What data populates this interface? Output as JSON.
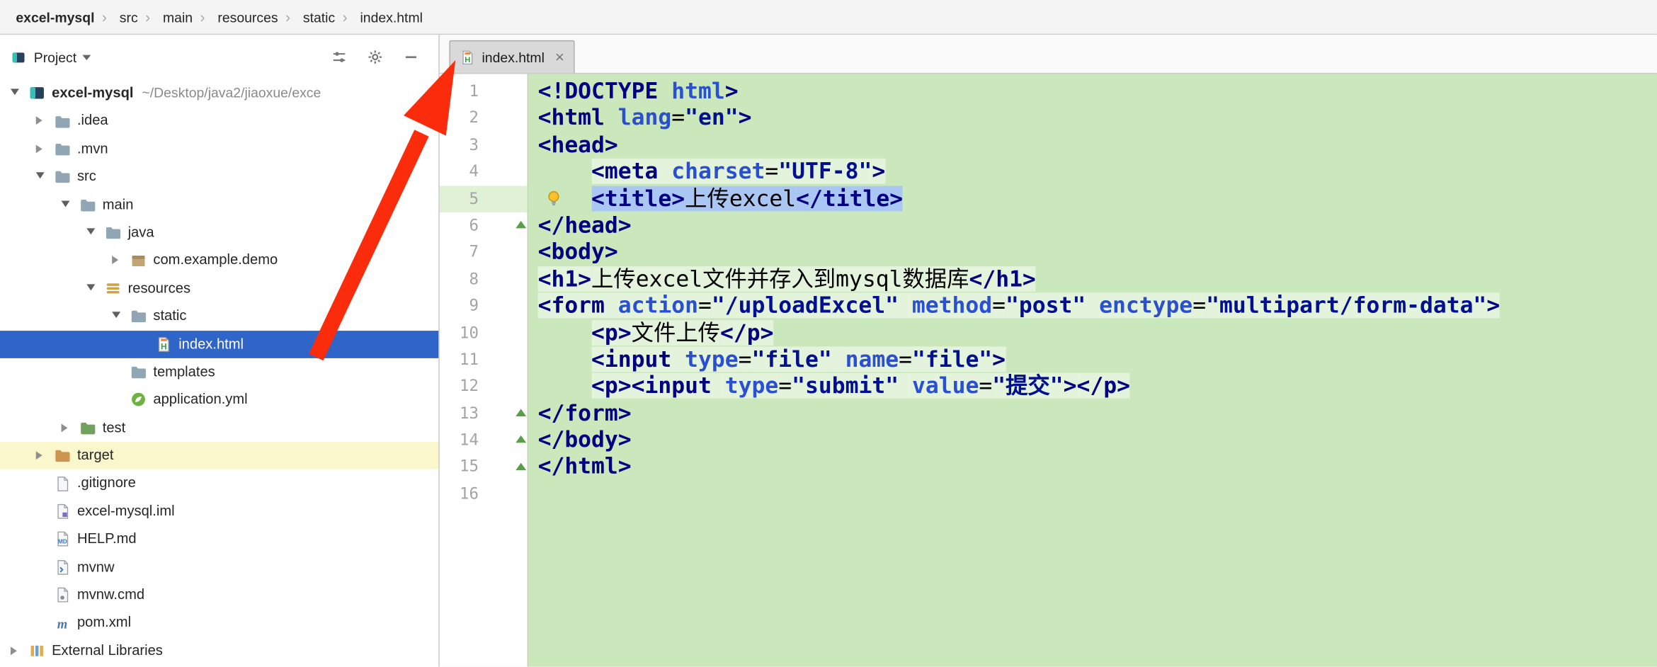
{
  "breadcrumbs": {
    "separator": "›",
    "items": [
      {
        "label": "excel-mysql",
        "icon": "module"
      },
      {
        "label": "src",
        "icon": "folder"
      },
      {
        "label": "main",
        "icon": "folder"
      },
      {
        "label": "resources",
        "icon": "resources"
      },
      {
        "label": "static",
        "icon": "folder"
      },
      {
        "label": "index.html",
        "icon": "html"
      }
    ]
  },
  "project_panel": {
    "title": "Project",
    "tree": [
      {
        "label": "excel-mysql",
        "path_hint": "~/Desktop/java2/jiaoxue/exce",
        "level": 0,
        "arrow": "expanded",
        "icon": "module",
        "bold": true
      },
      {
        "label": ".idea",
        "level": 1,
        "arrow": "collapsed",
        "icon": "folder"
      },
      {
        "label": ".mvn",
        "level": 1,
        "arrow": "collapsed",
        "icon": "folder"
      },
      {
        "label": "src",
        "level": 1,
        "arrow": "expanded",
        "icon": "folder"
      },
      {
        "label": "main",
        "level": 2,
        "arrow": "expanded",
        "icon": "folder"
      },
      {
        "label": "java",
        "level": 3,
        "arrow": "expanded",
        "icon": "folder"
      },
      {
        "label": "com.example.demo",
        "level": 4,
        "arrow": "collapsed",
        "icon": "package"
      },
      {
        "label": "resources",
        "level": 3,
        "arrow": "expanded",
        "icon": "resources"
      },
      {
        "label": "static",
        "level": 4,
        "arrow": "expanded",
        "icon": "folder"
      },
      {
        "label": "index.html",
        "level": 5,
        "arrow": "none",
        "icon": "html",
        "selected": true
      },
      {
        "label": "templates",
        "level": 4,
        "arrow": "none",
        "icon": "folder"
      },
      {
        "label": "application.yml",
        "level": 4,
        "arrow": "none",
        "icon": "yml"
      },
      {
        "label": "test",
        "level": 2,
        "arrow": "collapsed",
        "icon": "folder-test"
      },
      {
        "label": "target",
        "level": 1,
        "arrow": "collapsed",
        "icon": "folder-excluded",
        "highlight": "target"
      },
      {
        "label": ".gitignore",
        "level": 1,
        "arrow": "none",
        "icon": "file"
      },
      {
        "label": "excel-mysql.iml",
        "level": 1,
        "arrow": "none",
        "icon": "iml"
      },
      {
        "label": "HELP.md",
        "level": 1,
        "arrow": "none",
        "icon": "md"
      },
      {
        "label": "mvnw",
        "level": 1,
        "arrow": "none",
        "icon": "script"
      },
      {
        "label": "mvnw.cmd",
        "level": 1,
        "arrow": "none",
        "icon": "cmd"
      },
      {
        "label": "pom.xml",
        "level": 1,
        "arrow": "none",
        "icon": "maven"
      },
      {
        "label": "External Libraries",
        "level": 0,
        "arrow": "collapsed",
        "icon": "libraries"
      }
    ]
  },
  "editor": {
    "tab": {
      "label": "index.html",
      "close": "×",
      "icon": "html"
    },
    "gutter": {
      "bulb_line": 5,
      "fold_lines": [
        6,
        13,
        14,
        15
      ]
    },
    "lines": [
      [
        [
          "<!DOCTYPE ",
          "tag"
        ],
        [
          "html",
          "attr"
        ],
        [
          ">",
          "tag"
        ]
      ],
      [
        [
          "<html ",
          "tag"
        ],
        [
          "lang",
          "attr"
        ],
        [
          "=",
          "pln"
        ],
        [
          "\"en\"",
          "val"
        ],
        [
          ">",
          "tag"
        ]
      ],
      [
        [
          "<head>",
          "tag"
        ]
      ],
      [
        [
          "    ",
          "pln"
        ],
        [
          "<meta ",
          "tag hl"
        ],
        [
          "charset",
          "attr hl"
        ],
        [
          "=",
          "pln hl"
        ],
        [
          "\"UTF-8\"",
          "val hl"
        ],
        [
          ">",
          "tag hl"
        ]
      ],
      [
        [
          "    ",
          "pln"
        ],
        [
          "<title>",
          "tag sel"
        ],
        [
          "上传excel",
          "pln sel"
        ],
        [
          "</title>",
          "tag sel"
        ]
      ],
      [
        [
          "</head>",
          "tag"
        ]
      ],
      [
        [
          "<body>",
          "tag"
        ]
      ],
      [
        [
          "<h1>",
          "tag hl"
        ],
        [
          "上传excel文件并存入到mysql数据库",
          "pln hl"
        ],
        [
          "</h1>",
          "tag hl"
        ]
      ],
      [
        [
          "<form ",
          "tag hl"
        ],
        [
          "action",
          "attr hl"
        ],
        [
          "=",
          "pln hl"
        ],
        [
          "\"/uploadExcel\"",
          "val hl"
        ],
        [
          " ",
          "pln hl"
        ],
        [
          "method",
          "attr hl"
        ],
        [
          "=",
          "pln hl"
        ],
        [
          "\"post\"",
          "val hl"
        ],
        [
          " ",
          "pln hl"
        ],
        [
          "enctype",
          "attr hl"
        ],
        [
          "=",
          "pln hl"
        ],
        [
          "\"multipart/form-data\"",
          "val hl"
        ],
        [
          ">",
          "tag hl"
        ]
      ],
      [
        [
          "    ",
          "pln"
        ],
        [
          "<p>",
          "tag hl"
        ],
        [
          "文件上传",
          "pln hl"
        ],
        [
          "</p>",
          "tag hl"
        ]
      ],
      [
        [
          "    ",
          "pln"
        ],
        [
          "<input ",
          "tag hl"
        ],
        [
          "type",
          "attr hl"
        ],
        [
          "=",
          "pln hl"
        ],
        [
          "\"file\"",
          "val hl"
        ],
        [
          " ",
          "pln hl"
        ],
        [
          "name",
          "attr hl"
        ],
        [
          "=",
          "pln hl"
        ],
        [
          "\"file\"",
          "val hl"
        ],
        [
          ">",
          "tag hl"
        ]
      ],
      [
        [
          "    ",
          "pln"
        ],
        [
          "<p>",
          "tag hl"
        ],
        [
          "<input ",
          "tag hl"
        ],
        [
          "type",
          "attr hl"
        ],
        [
          "=",
          "pln hl"
        ],
        [
          "\"submit\"",
          "val hl"
        ],
        [
          " ",
          "pln hl"
        ],
        [
          "value",
          "attr hl"
        ],
        [
          "=",
          "pln hl"
        ],
        [
          "\"提交\"",
          "val hl"
        ],
        [
          ">",
          "tag hl"
        ],
        [
          "</p>",
          "tag hl"
        ]
      ],
      [
        [
          "</form>",
          "tag"
        ]
      ],
      [
        [
          "</body>",
          "tag"
        ]
      ],
      [
        [
          "</html>",
          "tag"
        ]
      ],
      []
    ]
  },
  "colors": {
    "tree_selection_blue": "#2f65c8",
    "editor_added_bg": "#cbe8bd",
    "code_selection_blue": "#a9c7f2",
    "target_row_highlight": "#fbf7cd",
    "annotation_arrow_red": "#fb2c0c"
  }
}
